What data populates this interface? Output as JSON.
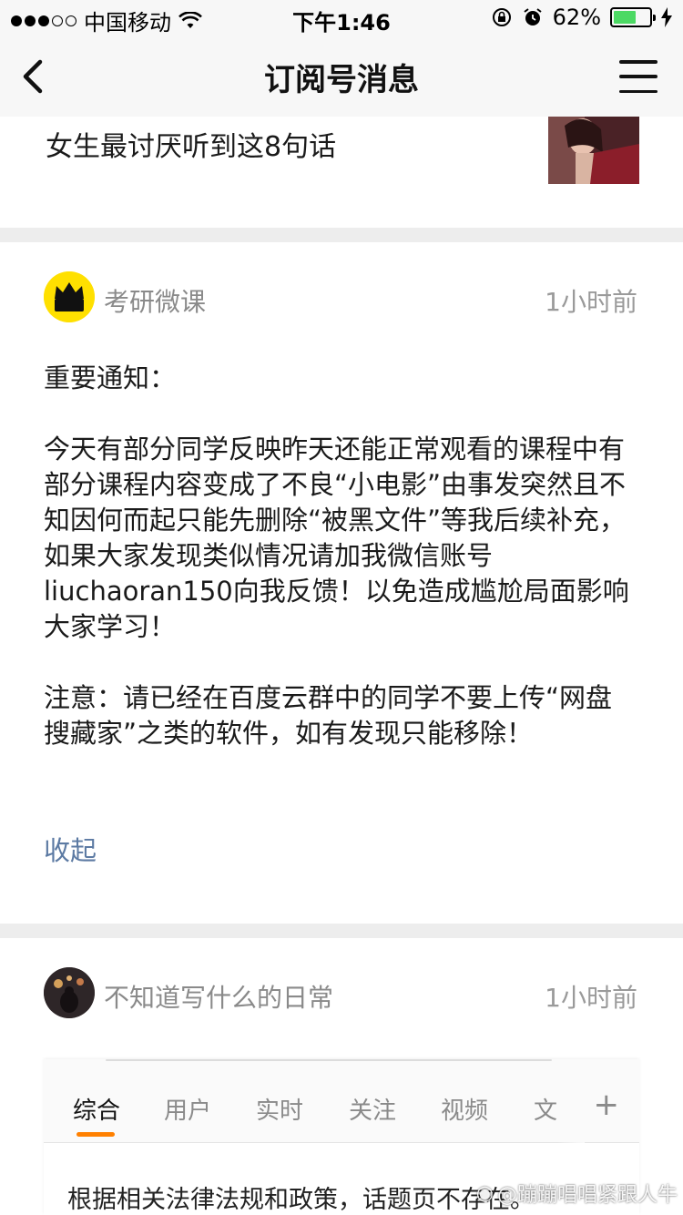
{
  "status_bar": {
    "carrier": "中国移动",
    "time": "下午1:46",
    "battery_percent": "62%",
    "battery_level": 0.62,
    "signal_filled": 3,
    "signal_total": 5
  },
  "nav": {
    "title": "订阅号消息"
  },
  "cards": [
    {
      "title": "女生最讨厌听到这8句话"
    },
    {
      "account": "考研微课",
      "avatar_text": "考研微课",
      "time": "1小时前",
      "message": {
        "heading": "重要通知：",
        "body": "今天有部分同学反映昨天还能正常观看的课程中有部分课程内容变成了不良“小电影”由事发突然且不知因何而起只能先删除“被黑文件”等我后续补充，如果大家发现类似情况请加我微信账号liuchaoran150向我反馈！以免造成尴尬局面影响大家学习！",
        "note": "注意：请已经在百度云群中的同学不要上传“网盘搜藏家”之类的软件，如有发现只能移除！"
      },
      "collapse_label": "收起"
    },
    {
      "account": "不知道写什么的日常",
      "time": "1小时前",
      "embed": {
        "tabs": [
          "综合",
          "用户",
          "实时",
          "关注",
          "视频",
          "文"
        ],
        "active_tab": 0,
        "add_label": "+",
        "text": "根据相关法律法规和政策，话题页不存在。"
      }
    }
  ],
  "watermark": "@蹦蹦唱唱紧跟人牛",
  "colors": {
    "link": "#5c7aa3",
    "tab_accent": "#ff8000",
    "battery_fill": "#4cd964",
    "avatar_yellow": "#ffe000"
  }
}
